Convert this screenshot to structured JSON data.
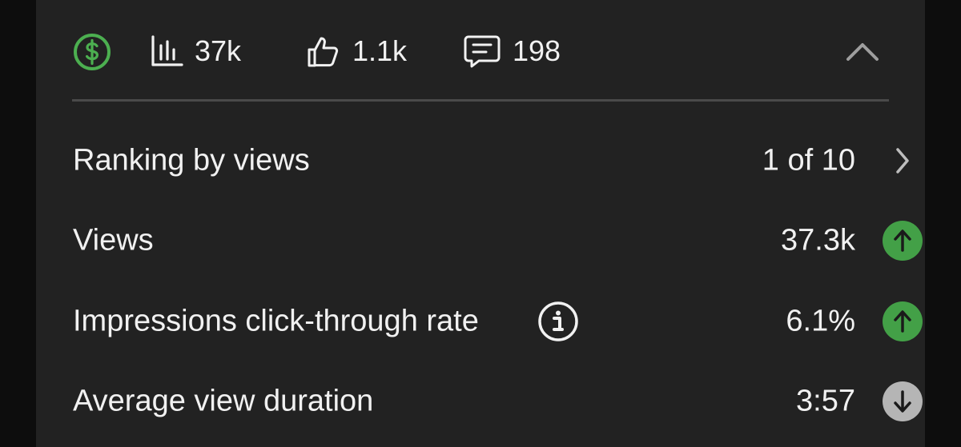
{
  "stats": {
    "monetization_icon": "dollar-circle-icon",
    "views": "37k",
    "likes": "1.1k",
    "comments": "198",
    "accent_color": "#4caf50"
  },
  "metrics": [
    {
      "label": "Ranking by views",
      "value": "1 of 10",
      "trail_icon": "chevron-right-icon"
    },
    {
      "label": "Views",
      "value": "37.3k",
      "trail_icon": "arrow-up-circle-icon",
      "trend": "up"
    },
    {
      "label": "Impressions click-through rate",
      "value": "6.1%",
      "trail_icon": "arrow-up-circle-icon",
      "trend": "up",
      "has_info": true
    },
    {
      "label": "Average view duration",
      "value": "3:57",
      "trail_icon": "arrow-down-circle-icon",
      "trend": "down"
    }
  ],
  "colors": {
    "up": "#43a047",
    "down": "#b5b5b5",
    "background": "#222222"
  }
}
